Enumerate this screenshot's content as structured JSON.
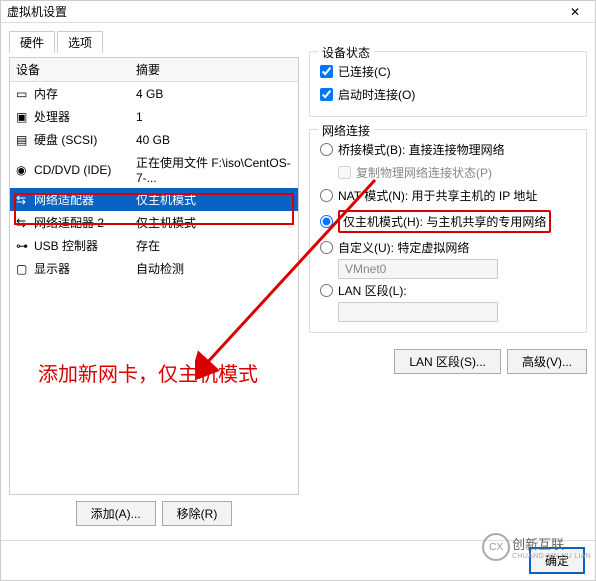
{
  "window": {
    "title": "虚拟机设置"
  },
  "tabs": {
    "hardware": "硬件",
    "options": "选项"
  },
  "header": {
    "device": "设备",
    "summary": "摘要"
  },
  "rows": {
    "memory": {
      "label": "内存",
      "val": "4 GB"
    },
    "cpu": {
      "label": "处理器",
      "val": "1"
    },
    "disk": {
      "label": "硬盘 (SCSI)",
      "val": "40 GB"
    },
    "cd": {
      "label": "CD/DVD (IDE)",
      "val": "正在使用文件 F:\\iso\\CentOS-7-..."
    },
    "net1": {
      "label": "网络适配器",
      "val": "仅主机模式"
    },
    "net2": {
      "label": "网络适配器 2",
      "val": "仅主机模式"
    },
    "usb": {
      "label": "USB 控制器",
      "val": "存在"
    },
    "display": {
      "label": "显示器",
      "val": "自动检测"
    }
  },
  "buttons": {
    "add": "添加(A)...",
    "remove": "移除(R)",
    "lanseg": "LAN 区段(S)...",
    "adv": "高级(V)...",
    "ok": "确定"
  },
  "status": {
    "title": "设备状态",
    "connected": "已连接(C)",
    "poweron": "启动时连接(O)"
  },
  "netconn": {
    "title": "网络连接",
    "bridge": "桥接模式(B): 直接连接物理网络",
    "replicate": "复制物理网络连接状态(P)",
    "nat": "NAT 模式(N): 用于共享主机的 IP 地址",
    "hostonly": "仅主机模式(H): 与主机共享的专用网络",
    "custom": "自定义(U): 特定虚拟网络",
    "vmnet": "VMnet0",
    "lan": "LAN 区段(L):"
  },
  "annotation": "添加新网卡，仅主机模式",
  "watermark": {
    "brand": "创新互联",
    "sub": "CHUANG XIN HU LIAN"
  }
}
